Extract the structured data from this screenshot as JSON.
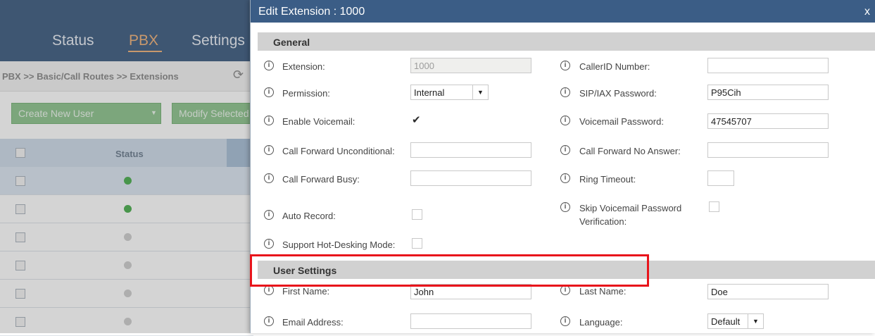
{
  "background": {
    "nav": {
      "tabs": [
        "Status",
        "PBX",
        "Settings"
      ],
      "active": "PBX"
    },
    "breadcrumb": "PBX >> Basic/Call Routes >> Extensions",
    "buttons": {
      "create": "Create New User",
      "modify": "Modify Selected"
    },
    "table": {
      "status_header": "Status"
    }
  },
  "dialog": {
    "title": "Edit Extension : 1000",
    "close": "x",
    "sections": {
      "general": "General",
      "user_settings": "User Settings"
    },
    "fields": {
      "extension": {
        "label": "Extension:",
        "value": "1000"
      },
      "callerid_number": {
        "label": "CallerID Number:",
        "value": ""
      },
      "permission": {
        "label": "Permission:",
        "value": "Internal"
      },
      "sip_iax_password": {
        "label": "SIP/IAX Password:",
        "value": "P95Cih"
      },
      "enable_voicemail": {
        "label": "Enable Voicemail:",
        "checked": true
      },
      "voicemail_password": {
        "label": "Voicemail Password:",
        "value": "47545707"
      },
      "cf_unconditional": {
        "label": "Call Forward Unconditional:",
        "value": ""
      },
      "cf_no_answer": {
        "label": "Call Forward No Answer:",
        "value": ""
      },
      "cf_busy": {
        "label": "Call Forward Busy:",
        "value": ""
      },
      "ring_timeout": {
        "label": "Ring Timeout:",
        "value": ""
      },
      "auto_record": {
        "label": "Auto Record:",
        "checked": false
      },
      "skip_vm_password": {
        "label_line1": "Skip Voicemail Password",
        "label_line2": "Verification:",
        "checked": false
      },
      "hot_desking": {
        "label": "Support Hot-Desking Mode:",
        "checked": false
      },
      "first_name": {
        "label": "First Name:",
        "value": "John"
      },
      "last_name": {
        "label": "Last Name:",
        "value": "Doe"
      },
      "email": {
        "label": "Email Address:",
        "value": ""
      },
      "language": {
        "label": "Language:",
        "value": "Default"
      }
    }
  },
  "colors": {
    "titlebar": "#3b5d86",
    "highlight": "#e8141b",
    "section": "#d1d1d1"
  }
}
